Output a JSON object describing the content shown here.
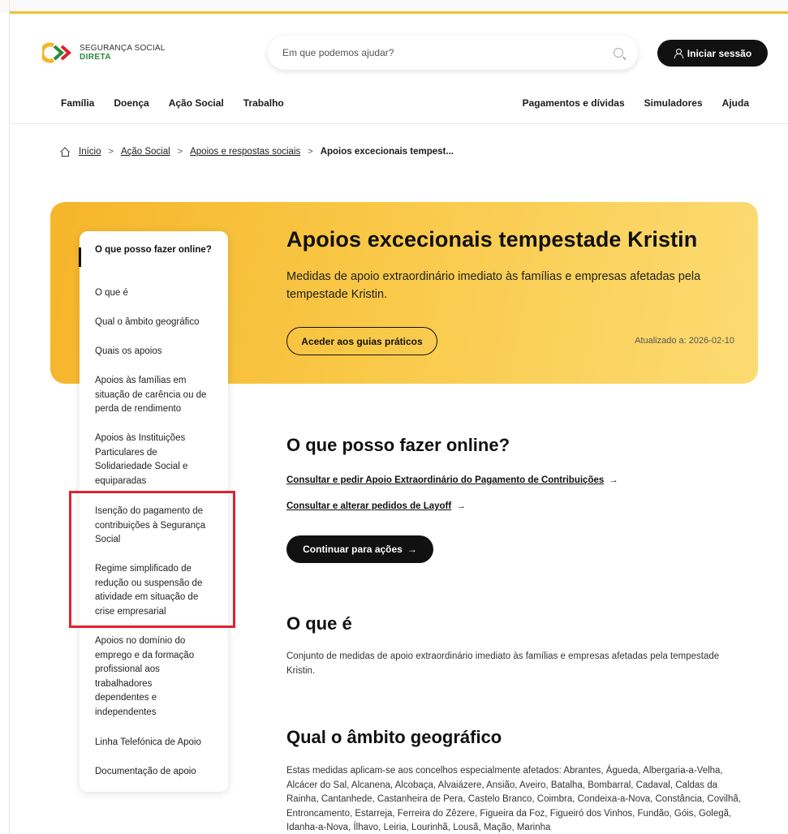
{
  "header": {
    "logo_line1": "SEGURANÇA SOCIAL",
    "logo_line2": "DIRETA",
    "search_placeholder": "Em que podemos ajudar?",
    "login_label": "Iniciar sessão",
    "nav_left": [
      "Família",
      "Doença",
      "Ação Social",
      "Trabalho"
    ],
    "nav_right": [
      "Pagamentos e dívidas",
      "Simuladores",
      "Ajuda"
    ]
  },
  "breadcrumb": {
    "items": [
      "Início",
      "Ação Social",
      "Apoios e respostas sociais"
    ],
    "current": "Apoios excecionais tempest..."
  },
  "hero": {
    "title": "Apoios excecionais tempestade Kristin",
    "description": "Medidas de apoio extraordinário imediato às famílias e empresas afetadas pela tempestade Kristin.",
    "button_label": "Aceder aos guias práticos",
    "updated": "Atualizado a: 2026-02-10"
  },
  "side_menu": {
    "items": [
      "O que posso fazer online?",
      "O que é",
      "Qual o âmbito geográfico",
      "Quais os apoios",
      "Apoios às famílias em situação de carência ou de perda de rendimento",
      "Apoios às Instituições Particulares de Solidariedade Social e equiparadas",
      "Isenção do pagamento de contribuições à Segurança Social",
      "Regime simplificado de redução ou suspensão de atividade em situação de crise empresarial",
      "Apoios no domínio do emprego e da formação profissional aos trabalhadores dependentes e independentes",
      "Linha Telefónica de Apoio",
      "Documentação de apoio"
    ]
  },
  "online": {
    "title": "O que posso fazer online?",
    "links": [
      "Consultar e pedir Apoio Extraordinário do Pagamento de Contribuições",
      "Consultar e alterar pedidos de Layoff"
    ],
    "button_label": "Continuar para ações"
  },
  "what_is": {
    "title": "O que é",
    "text": "Conjunto de medidas de apoio extraordinário imediato às famílias e empresas afetadas pela tempestade Kristin."
  },
  "scope": {
    "title": "Qual o âmbito geográfico",
    "text": "Estas medidas aplicam-se aos concelhos especialmente afetados: Abrantes, Águeda, Albergaria-a-Velha, Alcácer do Sal, Alcanena, Alcobaça, Alvaiázere, Ansião, Aveiro, Batalha, Bombarral, Cadaval, Caldas da Rainha, Cantanhede, Castanheira de Pera, Castelo Branco, Coimbra, Condeixa-a-Nova, Constância, Covilhã, Entroncamento, Estarreja, Ferreira do Zêzere, Figueira da Foz, Figueiró dos Vinhos, Fundão, Góis, Golegã, Idanha-a-Nova, Ílhavo, Leiria, Lourinhã, Lousã, Mação, Marinha"
  },
  "colors": {
    "accent_yellow": "#f9c847",
    "highlight_red": "#e0222f",
    "brand_green": "#2a8a3a"
  }
}
